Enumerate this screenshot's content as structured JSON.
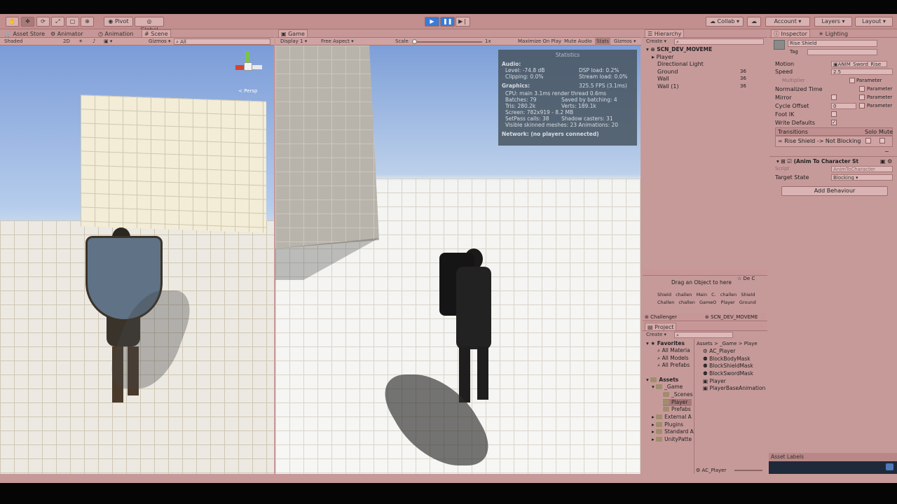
{
  "toolbar": {
    "pivot": "Pivot",
    "global": "Global",
    "collab": "Collab",
    "account": "Account",
    "layers": "Layers",
    "layout": "Layout"
  },
  "scene_tabs": {
    "asset_store": "Asset Store",
    "animator": "Animator",
    "animation": "Animation",
    "scene": "Scene"
  },
  "scene_bar": {
    "shaded": "Shaded",
    "mode2d": "2D",
    "gizmos": "Gizmos",
    "search": "All",
    "persp": "Persp"
  },
  "game": {
    "tab": "Game",
    "display": "Display 1",
    "aspect": "Free Aspect",
    "scale": "Scale",
    "scale_value": "1x",
    "maximize": "Maximize On Play",
    "mute": "Mute Audio",
    "stats": "Stats",
    "gizmos": "Gizmos"
  },
  "stats": {
    "title": "Statistics",
    "audio": "Audio:",
    "level": "Level: -74.8 dB",
    "clipping": "Clipping: 0.0%",
    "dsp": "DSP load: 0.2%",
    "stream": "Stream load: 0.0%",
    "graphics": "Graphics:",
    "fps": "325.5 FPS (3.1ms)",
    "cpu": "CPU: main 3.1ms  render thread 0.6ms",
    "batches": "Batches: 79",
    "saved": "Saved by batching: 4",
    "tris": "Tris: 280.2k",
    "verts": "Verts: 189.1k",
    "screen": "Screen: 782x919 - 8.2 MB",
    "setpass": "SetPass calls: 38",
    "shadow": "Shadow casters: 31",
    "skinned": "Visible skinned meshes: 23  Animations: 20",
    "network": "Network: (no players connected)"
  },
  "hierarchy": {
    "tab": "Hierarchy",
    "create": "Create",
    "scene": "SCN_DEV_MOVEME",
    "items": [
      {
        "label": "Player",
        "value": ""
      },
      {
        "label": "Directional Light",
        "value": ""
      },
      {
        "label": "Ground",
        "value": "36"
      },
      {
        "label": "Wall",
        "value": "36"
      },
      {
        "label": "Wall (1)",
        "value": "36"
      }
    ]
  },
  "drag": {
    "hint": "Drag an Object to here",
    "dec": "De C",
    "row1": [
      "Shield",
      "challen",
      "Main C.",
      "challen",
      "Shield"
    ],
    "row2": [
      "Challen",
      "challen",
      "GameO",
      "Player",
      "Ground"
    ]
  },
  "split_bar": {
    "challenger": "Challenger",
    "scene": "SCN_DEV_MOVEME"
  },
  "project": {
    "tab": "Project",
    "create": "Create",
    "favorites": "Favorites",
    "fav_items": [
      "All Materia",
      "All Models",
      "All Prefabs"
    ],
    "assets": "Assets",
    "tree": [
      "_Game",
      "_Scenes",
      "Player",
      "Prefabs",
      "External A",
      "Plugins",
      "Standard A",
      "UnityPatte"
    ],
    "breadcrumb": "Assets > _Game > Playe",
    "files": [
      "AC_Player",
      "BlockBodyMask",
      "BlockShieldMask",
      "BlockSwordMask",
      "Player",
      "PlayerBaseAnimation"
    ],
    "footer": "AC_Player"
  },
  "inspector": {
    "tab": "Inspector",
    "lighting": "Lighting",
    "name": "Rise Shield",
    "tag": "Tag",
    "motion_label": "Motion",
    "motion_value": "ANIM_Sword_Rise",
    "speed_label": "Speed",
    "speed_value": "2.5",
    "multiplier": "Multiplier",
    "parameter": "Parameter",
    "normalized_time": "Normalized Time",
    "mirror": "Mirror",
    "cycle_offset": "Cycle Offset",
    "cycle_value": "0",
    "foot_ik": "Foot IK",
    "write_defaults": "Write Defaults",
    "transitions": "Transitions",
    "solo": "Solo",
    "mute": "Mute",
    "transition_item": "Rise Shield -> Not Blocking",
    "behaviour": "(Anim To Character St",
    "script_label": "Script",
    "script_value": "AnimToCharacter",
    "target_label": "Target State",
    "target_value": "Blocking",
    "add_behaviour": "Add Behaviour",
    "asset_labels": "Asset Labels"
  },
  "colors": {
    "tint": "#c79a9a",
    "play_blue": "#3a7bd5",
    "stats_bg": "#46545e"
  }
}
